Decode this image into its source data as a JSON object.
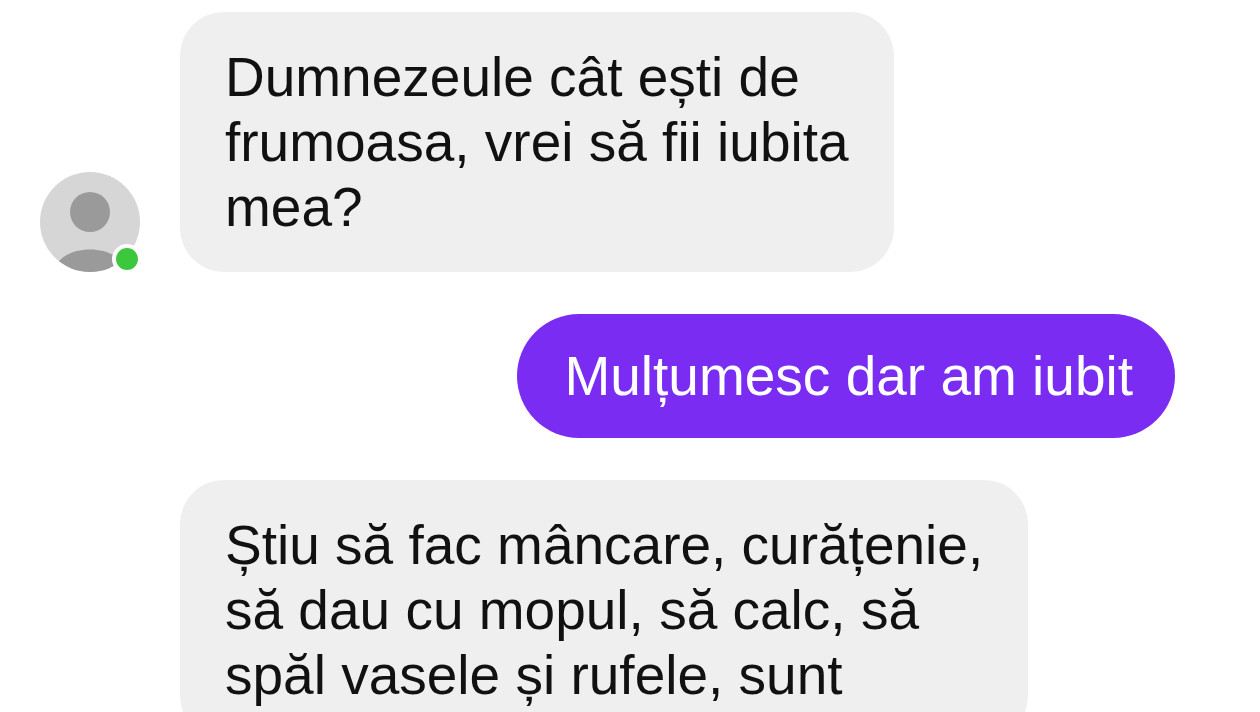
{
  "messages": [
    {
      "kind": "incoming",
      "show_avatar": true,
      "online": true,
      "text": "Dumnezeule cât ești de\nfrumoasa, vrei să fii iubita\nmea?"
    },
    {
      "kind": "outgoing",
      "text": "Mulțumesc dar am iubit"
    },
    {
      "kind": "incoming",
      "text": "Știu să fac mâncare, curățenie,\nsă dau cu mopul, să calc, să\nspăl vasele și rufele, sunt"
    }
  ]
}
